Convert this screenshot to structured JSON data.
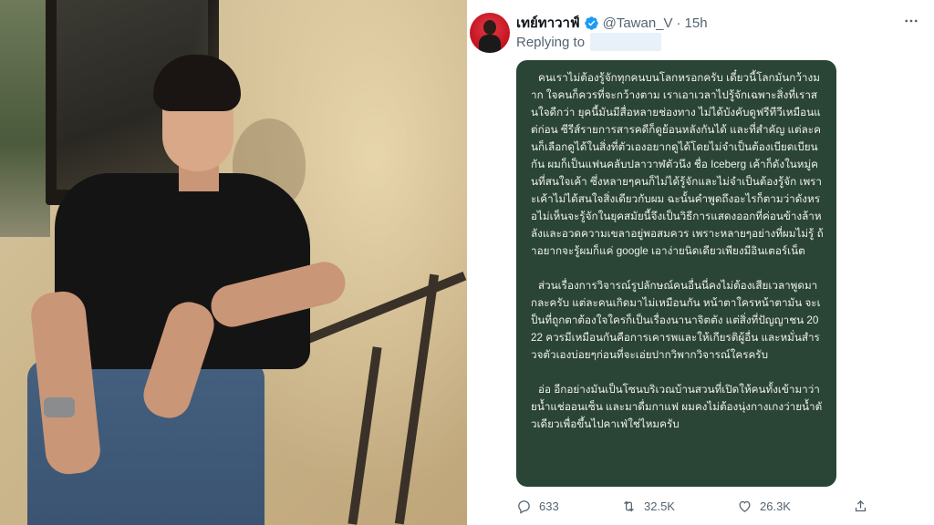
{
  "tweet": {
    "display_name": "เทย์ทาวาฟ์",
    "handle": "@Tawan_V",
    "separator": "·",
    "time": "15h",
    "reply_label": "Replying to",
    "verified_icon": "verified-badge-icon",
    "body_paragraphs": [
      "คนเราไม่ต้องรู้จักทุกคนบนโลกหรอกครับ เดี๋ยวนี้โลกมันกว้างมาก ใจคนก็ควรที่จะกว้างตาม เราเอาเวลาไปรู้จักเฉพาะสิ่งที่เราสนใจดีกว่า ยุคนี้มันมีสื่อหลายช่องทาง ไม่ได้บังคับดูฟรีทีวีเหมือนแต่ก่อน ซีรีส์รายการสารคดีก็ดูย้อนหลังกันได้ และที่สำคัญ แต่ละคนก็เลือกดูได้ในสิ่งที่ตัวเองอยากดูได้โดยไม่จำเป็นต้องเบียดเบียนกัน ผมก็เป็นแฟนคลับปลาวาฬตัวนึง ชื่อ Iceberg เค้าก็ดังในหมู่คนที่สนใจเค้า ซึ่งหลายๆคนก็ไม่ได้รู้จักและไม่จำเป็นต้องรู้จัก เพราะเค้าไม่ได้สนใจสิ่งเดียวกับผม ฉะนั้นคำพูดถึงอะไรก็ตามว่าดังหรอไม่เห็นจะรู้จักในยุคสมัยนี้จึงเป็นวิธีการแสดงออกที่ค่อนข้างล้าหลังและอวดความเขลาอยู่พอสมควร เพราะหลายๆอย่างที่ผมไม่รู้ ถ้าอยากจะรู้ผมก็แค่ google เอาง่ายนิดเดียวเพียงมีอินเตอร์เน็ต",
      "ส่วนเรื่องการวิจารณ์รูปลักษณ์คนอื่นนี่คงไม่ต้องเสียเวลาพูดมากละครับ แต่ละคนเกิดมาไม่เหมือนกัน หน้าตาใครหน้าตามัน จะเป็นที่ถูกตาต้องใจใครก็เป็นเรื่องนานาจิตตัง แต่สิ่งที่ปัญญาชน 2022 ควรมีเหมือนกันคือการเคารพและให้เกียรติผู้อื่น และหมั่นสำรวจตัวเองบ่อยๆก่อนที่จะเอ่ยปากวิพากวิจารณ์ใครครับ",
      "อ่อ อีกอย่างมันเป็นโซนบริเวณบ้านสวนที่เปิดให้คนทั้งเข้ามาว่ายน้ำแช่ออนเซ็น และมาดื่มกาแฟ ผมคงไม่ต้องนุ่งกางเกงว่ายน้ำตัวเดียวเพื่อขึ้นไปคาเฟ่ใช่ไหมครับ"
    ],
    "card_color": "#2a4535",
    "stats": {
      "replies": "633",
      "retweets": "32.5K",
      "likes": "26.3K"
    },
    "icons": {
      "reply": "reply-icon",
      "retweet": "retweet-icon",
      "like": "heart-icon",
      "share": "share-icon",
      "more": "more-icon"
    }
  }
}
